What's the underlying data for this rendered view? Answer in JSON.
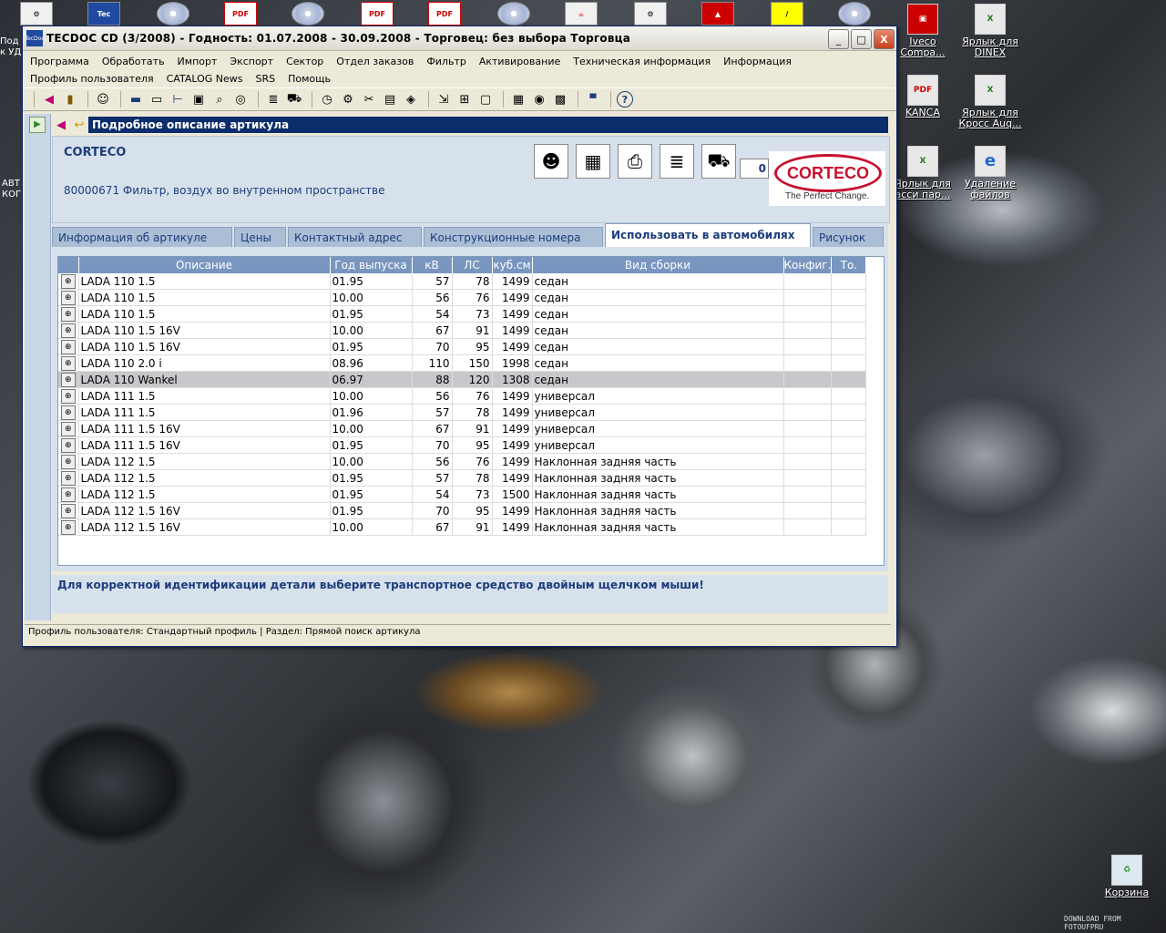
{
  "desktop": {
    "top_left_labels": [
      "Под",
      "к УД"
    ],
    "left_labels": [
      "АВТ",
      "КОГ"
    ],
    "right_icons": [
      {
        "label": "Iveco Compa...",
        "icon": "shortcut-icon"
      },
      {
        "label": "Ярлык для DINEX",
        "icon": "excel-icon"
      },
      {
        "label": "KANCA",
        "icon": "pdf-icon"
      },
      {
        "label": "Ярлык для Кросс Auq...",
        "icon": "excel-icon"
      },
      {
        "label": "Ярлык для асси пар...",
        "icon": "excel-icon"
      },
      {
        "label": "Удаление файлов",
        "icon": "ie-icon"
      }
    ],
    "recycle_bin": "Корзина",
    "watermark": "DOWNLOAD FROM FOTOUFPRU",
    "top_icon_tags": [
      "Tec",
      "PDF",
      "PDF",
      "PDF"
    ]
  },
  "window": {
    "title": "TECDOC CD (3/2008)  -  Годность: 01.07.2008 - 30.09.2008  -  Торговец: без выбора Торговца",
    "logo_text": "TecDoc",
    "controls": {
      "minimize": "_",
      "maximize": "□",
      "close": "X"
    }
  },
  "menu": [
    "Программа",
    "Обработать",
    "Импорт",
    "Экспорт",
    "Сектор",
    "Отдел заказов",
    "Фильтр",
    "Активирование",
    "Техническая информация",
    "Информация",
    "Профиль пользователя",
    "CATALOG News",
    "SRS",
    "Помощь"
  ],
  "panel": {
    "title": "Подробное описание артикула",
    "manufacturer": "CORTECO",
    "description": "80000671 Фильтр, воздух во внутренном пространстве",
    "counter": "0",
    "logo_text": "CORTECO",
    "logo_tagline": "The Perfect Change."
  },
  "tabs": [
    {
      "label": "Информация об артикуле",
      "active": false
    },
    {
      "label": "Цены",
      "active": false
    },
    {
      "label": "Контактный адрес",
      "active": false
    },
    {
      "label": "Конструкционные номера",
      "active": false
    },
    {
      "label": "Использовать в автомобилях",
      "active": true
    },
    {
      "label": "Рисунок",
      "active": false
    }
  ],
  "table": {
    "headers": [
      "",
      "Описание",
      "Год выпуска",
      "кВ",
      "ЛС",
      "куб.см",
      "Вид сборки",
      "Конфиг.",
      "То."
    ],
    "rows": [
      {
        "desc": "LADA 110 1.5",
        "year": "01.95",
        "kw": "57",
        "ls": "78",
        "cc": "1499",
        "body": "седан",
        "selected": false
      },
      {
        "desc": "LADA 110 1.5",
        "year": "10.00",
        "kw": "56",
        "ls": "76",
        "cc": "1499",
        "body": "седан",
        "selected": false
      },
      {
        "desc": "LADA 110 1.5",
        "year": "01.95",
        "kw": "54",
        "ls": "73",
        "cc": "1499",
        "body": "седан",
        "selected": false
      },
      {
        "desc": "LADA 110 1.5 16V",
        "year": "10.00",
        "kw": "67",
        "ls": "91",
        "cc": "1499",
        "body": "седан",
        "selected": false
      },
      {
        "desc": "LADA 110 1.5 16V",
        "year": "01.95",
        "kw": "70",
        "ls": "95",
        "cc": "1499",
        "body": "седан",
        "selected": false
      },
      {
        "desc": "LADA 110 2.0 i",
        "year": "08.96",
        "kw": "110",
        "ls": "150",
        "cc": "1998",
        "body": "седан",
        "selected": false
      },
      {
        "desc": "LADA 110 Wankel",
        "year": "06.97",
        "kw": "88",
        "ls": "120",
        "cc": "1308",
        "body": "седан",
        "selected": true
      },
      {
        "desc": "LADA 111 1.5",
        "year": "10.00",
        "kw": "56",
        "ls": "76",
        "cc": "1499",
        "body": "универсал",
        "selected": false
      },
      {
        "desc": "LADA 111 1.5",
        "year": "01.96",
        "kw": "57",
        "ls": "78",
        "cc": "1499",
        "body": "универсал",
        "selected": false
      },
      {
        "desc": "LADA 111 1.5 16V",
        "year": "10.00",
        "kw": "67",
        "ls": "91",
        "cc": "1499",
        "body": "универсал",
        "selected": false
      },
      {
        "desc": "LADA 111 1.5 16V",
        "year": "01.95",
        "kw": "70",
        "ls": "95",
        "cc": "1499",
        "body": "универсал",
        "selected": false
      },
      {
        "desc": "LADA 112 1.5",
        "year": "10.00",
        "kw": "56",
        "ls": "76",
        "cc": "1499",
        "body": "Наклонная задняя часть",
        "selected": false
      },
      {
        "desc": "LADA 112 1.5",
        "year": "01.95",
        "kw": "57",
        "ls": "78",
        "cc": "1499",
        "body": "Наклонная задняя часть",
        "selected": false
      },
      {
        "desc": "LADA 112 1.5",
        "year": "01.95",
        "kw": "54",
        "ls": "73",
        "cc": "1500",
        "body": "Наклонная задняя часть",
        "selected": false
      },
      {
        "desc": "LADA 112 1.5 16V",
        "year": "01.95",
        "kw": "70",
        "ls": "95",
        "cc": "1499",
        "body": "Наклонная задняя часть",
        "selected": false
      },
      {
        "desc": "LADA 112 1.5 16V",
        "year": "10.00",
        "kw": "67",
        "ls": "91",
        "cc": "1499",
        "body": "Наклонная задняя часть",
        "selected": false
      }
    ]
  },
  "hint": "Для корректной идентификации детали выберите транспортное средство двойным щелчком мыши!",
  "status": "Профиль пользователя: Стандартный профиль | Раздел: Прямой поиск артикула"
}
